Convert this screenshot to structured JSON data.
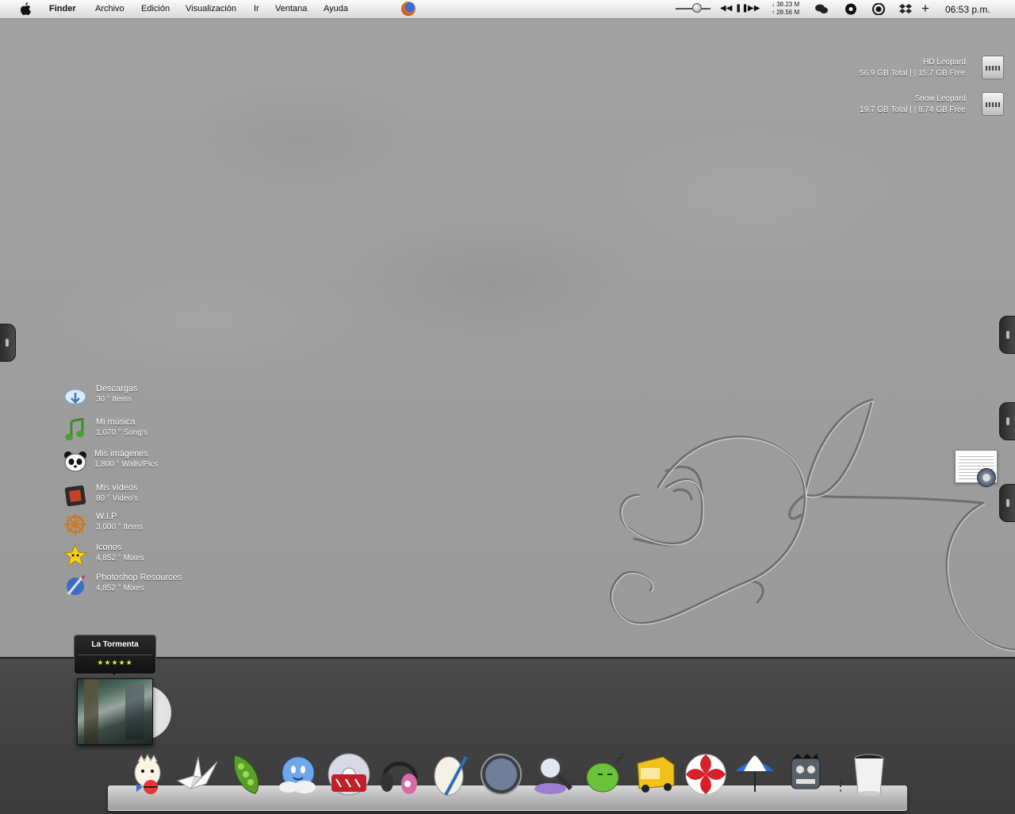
{
  "menubar": {
    "app_name": "Finder",
    "menus": [
      "Archivo",
      "Edición",
      "Visualización",
      "Ir",
      "Ventana",
      "Ayuda"
    ],
    "network": {
      "down": "38.23 M",
      "up": "28.56 M"
    },
    "clock": "06:53 p.m.",
    "icons": [
      "apple-icon",
      "firefox-icon",
      "volume-slider",
      "rewind-icon",
      "pause-icon",
      "forward-icon",
      "chat-icon",
      "record-icon",
      "target-icon",
      "dropbox-icon",
      "plus-icon"
    ]
  },
  "drives": [
    {
      "name": "HD Leopard",
      "info": "56.9 GB Total  | |  15.7 GB Free"
    },
    {
      "name": "Snow Leopard",
      "info": "19.7 GB Total  | |  8.74 GB Free"
    }
  ],
  "folders": [
    {
      "title": "Descargas",
      "sub": "30  °  Items",
      "icon": "cloud-download-icon"
    },
    {
      "title": "Mi música",
      "sub": "1,070  °  Song's",
      "icon": "music-note-icon"
    },
    {
      "title": "Mis imágenes",
      "sub": "1,800  °  Walls/Pics",
      "icon": "panda-icon"
    },
    {
      "title": "Mis vídeos",
      "sub": "80  °  Video's",
      "icon": "film-icon"
    },
    {
      "title": "W.I.P",
      "sub": "3,000  °  Items",
      "icon": "ship-wheel-icon"
    },
    {
      "title": "Iconos",
      "sub": "4,852  °  Mixes",
      "icon": "star-icon"
    },
    {
      "title": "Photoshop Resources",
      "sub": "4,852  °  Mixes",
      "icon": "paintbrush-icon"
    }
  ],
  "now_playing": {
    "title": "La Tormenta",
    "rating": "★★★★★"
  },
  "dock": {
    "items": [
      "togepi-icon",
      "paper-crane-icon",
      "pea-pod-icon",
      "cloud-face-icon",
      "cd-burner-icon",
      "headphones-icon",
      "feather-egg-icon",
      "safari-compass-icon",
      "spotlight-magnifier-icon",
      "green-bird-icon",
      "delivery-truck-icon",
      "candy-icon",
      "umbrella-icon",
      "robot-head-icon",
      "trash-can-icon"
    ]
  }
}
